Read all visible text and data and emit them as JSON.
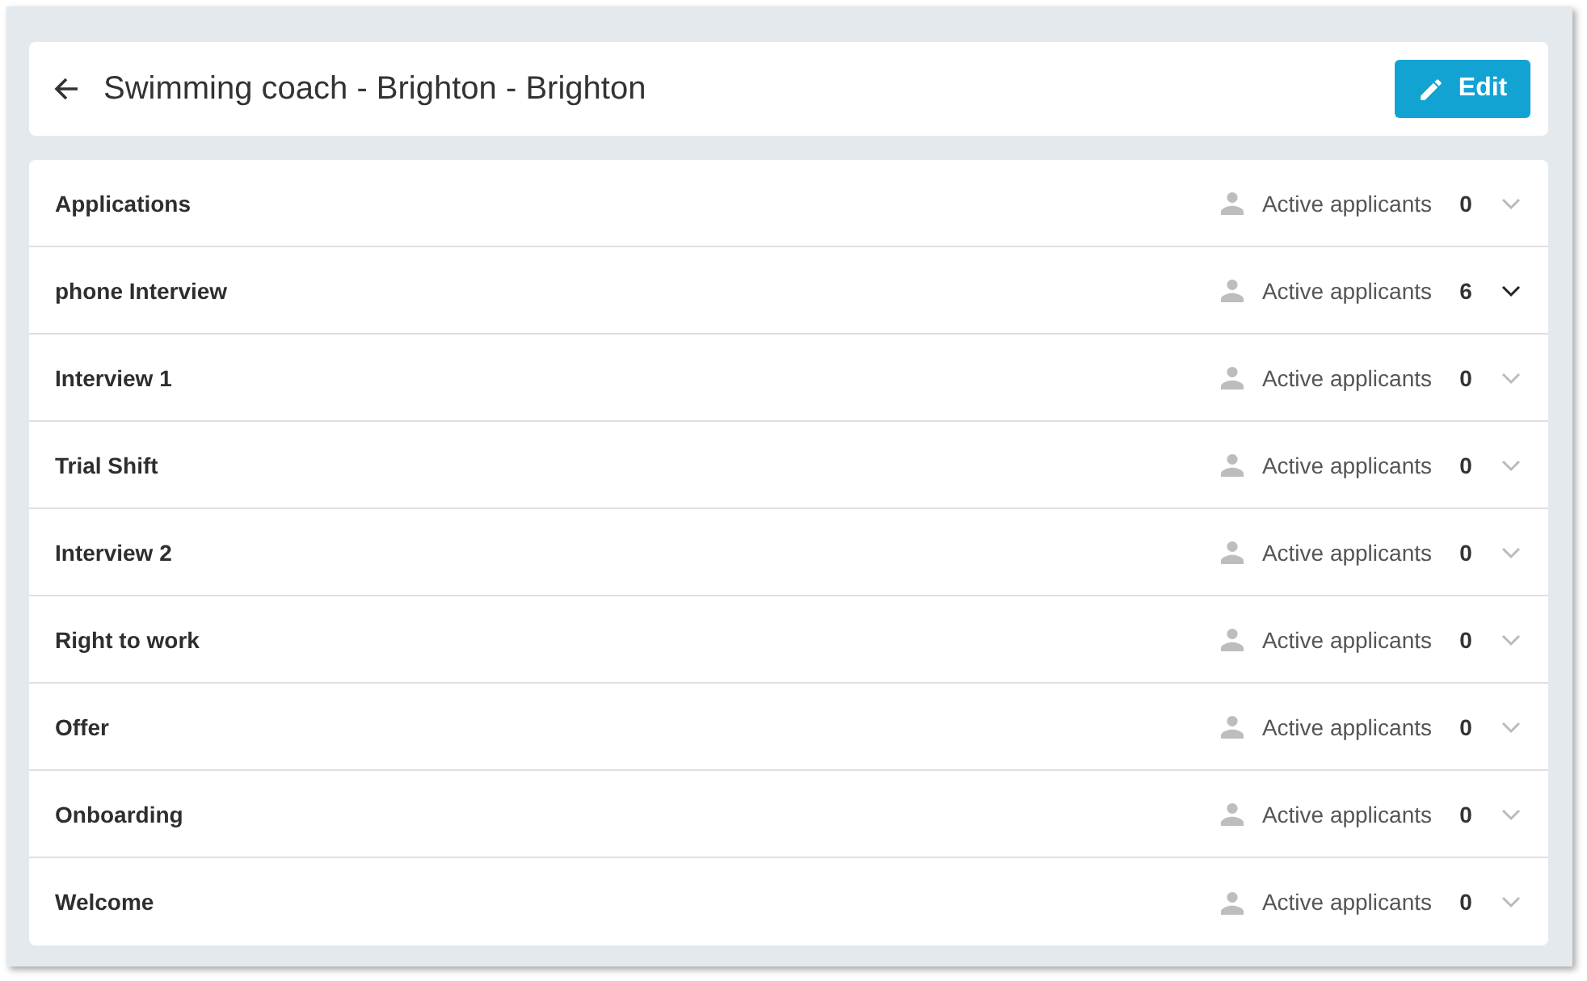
{
  "header": {
    "title": "Swimming coach - Brighton - Brighton",
    "edit_button": "Edit"
  },
  "stages": [
    {
      "name": "Applications",
      "label": "Active applicants",
      "count": "0",
      "disabled": true
    },
    {
      "name": "phone Interview",
      "label": "Active applicants",
      "count": "6",
      "disabled": false
    },
    {
      "name": "Interview 1",
      "label": "Active applicants",
      "count": "0",
      "disabled": true
    },
    {
      "name": "Trial Shift",
      "label": "Active applicants",
      "count": "0",
      "disabled": true
    },
    {
      "name": "Interview 2",
      "label": "Active applicants",
      "count": "0",
      "disabled": true
    },
    {
      "name": "Right to work",
      "label": "Active applicants",
      "count": "0",
      "disabled": true
    },
    {
      "name": "Offer",
      "label": "Active applicants",
      "count": "0",
      "disabled": true
    },
    {
      "name": "Onboarding",
      "label": "Active applicants",
      "count": "0",
      "disabled": true
    },
    {
      "name": "Welcome",
      "label": "Active applicants",
      "count": "0",
      "disabled": true
    }
  ]
}
